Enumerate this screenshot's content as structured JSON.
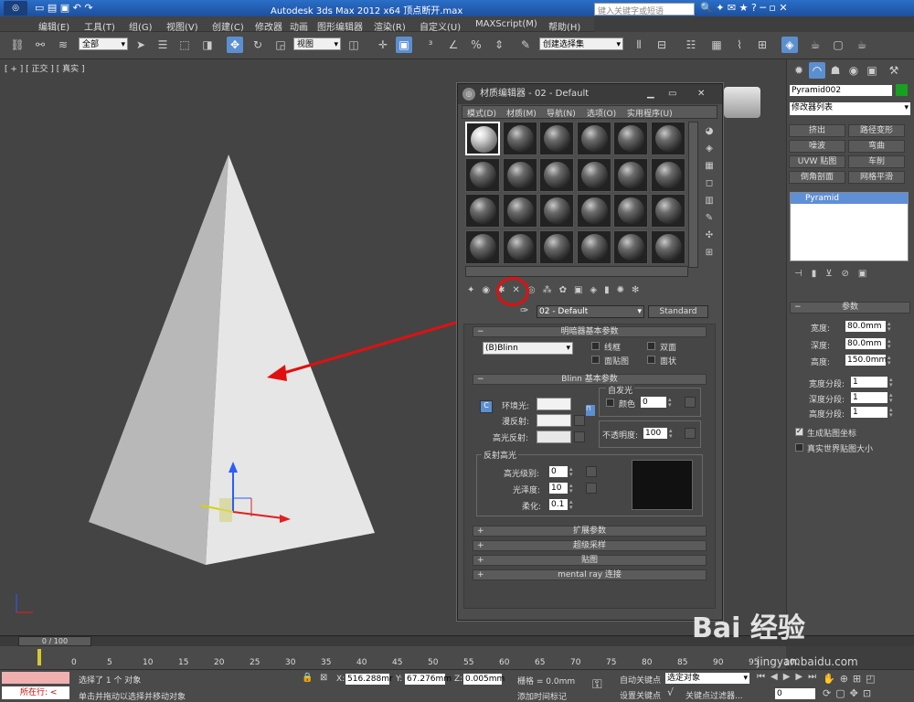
{
  "app": {
    "title": "Autodesk 3ds Max  2012 x64    顶点断开.max"
  },
  "menu": [
    "编辑(E)",
    "工具(T)",
    "组(G)",
    "视图(V)",
    "创建(C)",
    "修改器",
    "动画",
    "图形编辑器",
    "渲染(R)",
    "自定义(U)",
    "MAXScript(M)",
    "帮助(H)"
  ],
  "search_placeholder": "键入关键字或短语",
  "toolbar": {
    "selection_filter": "全部",
    "ref_coord": "视图",
    "named_sel": "创建选择集"
  },
  "viewport": {
    "label": "[ + ] [ 正交 ] [ 真实 ]"
  },
  "mated": {
    "title": "材质编辑器 - 02 - Default",
    "menu": [
      "模式(D)",
      "材质(M)",
      "导航(N)",
      "选项(O)",
      "实用程序(U)"
    ],
    "mat_name": "02 - Default",
    "mat_type": "Standard",
    "shader_rollout": "明暗器基本参数",
    "shader": "(B)Blinn",
    "shader_opts": [
      "线框",
      "双面",
      "面贴图",
      "面状"
    ],
    "blinn_rollout": "Blinn 基本参数",
    "self_illum": "自发光",
    "color_label": "颜色",
    "color_val": "0",
    "ambient": "环境光:",
    "diffuse": "漫反射:",
    "specular": "高光反射:",
    "opacity_label": "不透明度:",
    "opacity": "100",
    "spec_hl": "反射高光",
    "spec_level_label": "高光级别:",
    "spec_level": "0",
    "gloss_label": "光泽度:",
    "gloss": "10",
    "soften_label": "柔化:",
    "soften": "0.1",
    "rollouts": [
      "扩展参数",
      "超级采样",
      "贴图",
      "mental ray 连接"
    ]
  },
  "cmd": {
    "obj_name": "Pyramid002",
    "mod_list": "修改器列表",
    "buttons": [
      "挤出",
      "路径变形",
      "噪波",
      "弯曲",
      "UVW 贴图",
      "车削",
      "倒角剖面",
      "网格平滑"
    ],
    "stack_item": "Pyramid",
    "params_title": "参数",
    "width_label": "宽度:",
    "width": "80.0mm",
    "depth_label": "深度:",
    "depth": "80.0mm",
    "height_label": "高度:",
    "height": "150.0mm",
    "wseg_label": "宽度分段:",
    "wseg": "1",
    "dseg_label": "深度分段:",
    "dseg": "1",
    "hseg_label": "高度分段:",
    "hseg": "1",
    "gen_map": "生成贴图坐标",
    "real_world": "真实世界贴图大小"
  },
  "timeline": {
    "frame": "0 / 100",
    "ticks": [
      "0",
      "5",
      "10",
      "15",
      "20",
      "25",
      "30",
      "35",
      "40",
      "45",
      "50",
      "55",
      "60",
      "65",
      "70",
      "75",
      "80",
      "85",
      "90",
      "95",
      "100"
    ]
  },
  "status": {
    "script_label": "所在行:",
    "selected": "选择了 1 个 对象",
    "hint": "单击并拖动以选择并移动对象",
    "x": "516.288mr",
    "y": "67.276mm",
    "z": "0.005mm",
    "grid": "栅格 = 0.0mm",
    "add_time": "添加时间标记",
    "auto_key": "自动关键点",
    "set_key": "设置关键点",
    "sel_set": "选定对象",
    "key_filter": "关键点过滤器...",
    "frame": "0"
  },
  "watermark": {
    "text": "Bai 经验",
    "url": "jingyan.baidu.com"
  }
}
